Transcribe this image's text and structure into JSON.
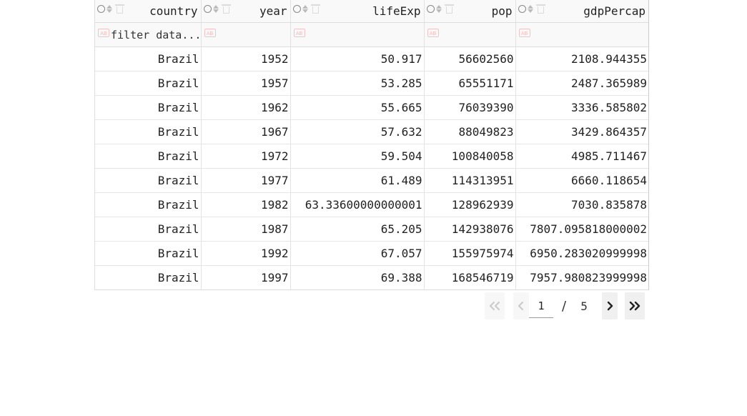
{
  "table": {
    "columns": [
      {
        "key": "country",
        "label": "country"
      },
      {
        "key": "year",
        "label": "year"
      },
      {
        "key": "lifeExp",
        "label": "lifeExp"
      },
      {
        "key": "pop",
        "label": "pop"
      },
      {
        "key": "gdpPercap",
        "label": "gdpPercap"
      }
    ],
    "filter_placeholder": "filter data...",
    "filter_badge": "AB",
    "rows": [
      [
        "Brazil",
        "1952",
        "50.917",
        "56602560",
        "2108.944355"
      ],
      [
        "Brazil",
        "1957",
        "53.285",
        "65551171",
        "2487.365989"
      ],
      [
        "Brazil",
        "1962",
        "55.665",
        "76039390",
        "3336.585802"
      ],
      [
        "Brazil",
        "1967",
        "57.632",
        "88049823",
        "3429.864357"
      ],
      [
        "Brazil",
        "1972",
        "59.504",
        "100840058",
        "4985.711467"
      ],
      [
        "Brazil",
        "1977",
        "61.489",
        "114313951",
        "6660.118654"
      ],
      [
        "Brazil",
        "1982",
        "63.33600000000001",
        "128962939",
        "7030.835878"
      ],
      [
        "Brazil",
        "1987",
        "65.205",
        "142938076",
        "7807.095818000002"
      ],
      [
        "Brazil",
        "1992",
        "67.057",
        "155975974",
        "6950.283020999998"
      ],
      [
        "Brazil",
        "1997",
        "69.388",
        "168546719",
        "7957.980823999998"
      ]
    ]
  },
  "pager": {
    "current_page": "1",
    "separator": "/",
    "total_pages": "5",
    "icons": {
      "first": "double-chevron-left-icon",
      "prev": "chevron-left-icon",
      "next": "chevron-right-icon",
      "last": "double-chevron-right-icon"
    }
  }
}
